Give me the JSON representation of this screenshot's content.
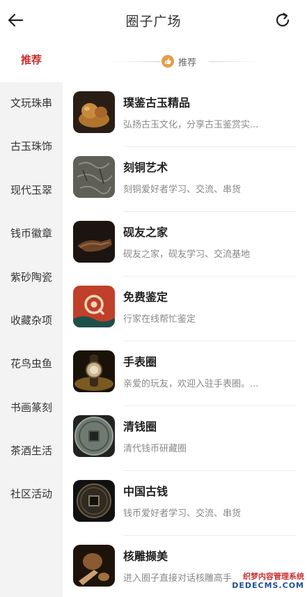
{
  "header": {
    "title": "圈子广场",
    "back_icon": "back-arrow-icon",
    "refresh_icon": "refresh-icon"
  },
  "sidebar": {
    "items": [
      {
        "label": "推荐",
        "active": true
      },
      {
        "label": "文玩珠串",
        "active": false
      },
      {
        "label": "古玉珠饰",
        "active": false
      },
      {
        "label": "现代玉翠",
        "active": false
      },
      {
        "label": "钱币徽章",
        "active": false
      },
      {
        "label": "紫砂陶瓷",
        "active": false
      },
      {
        "label": "收藏杂项",
        "active": false
      },
      {
        "label": "花鸟虫鱼",
        "active": false
      },
      {
        "label": "书画篆刻",
        "active": false
      },
      {
        "label": "茶酒生活",
        "active": false
      },
      {
        "label": "社区活动",
        "active": false
      }
    ]
  },
  "main": {
    "section_label": "推荐",
    "section_icon": "thumbs-up-icon",
    "circles": [
      {
        "name": "璞鉴古玉精品",
        "desc": "弘扬古玉文化，分享古玉鉴赏实..."
      },
      {
        "name": "刻铜艺术",
        "desc": "刻铜爱好者学习、交流、串货"
      },
      {
        "name": "砚友之家",
        "desc": "砚友之家，砚友学习、交流基地"
      },
      {
        "name": "免费鉴定",
        "desc": "行家在线帮忙鉴定"
      },
      {
        "name": "手表圈",
        "desc": "亲爱的玩友，欢迎入驻手表圈。..."
      },
      {
        "name": "清钱圈",
        "desc": "清代钱币研藏圈"
      },
      {
        "name": "中国古钱",
        "desc": "钱币爱好者学习、交流、串货"
      },
      {
        "name": "核雕撷美",
        "desc": "进入圈子直接对话核雕高手"
      }
    ]
  },
  "watermark": {
    "line1": "织梦内容管理系统",
    "line2": "DEDECMS.COM"
  },
  "colors": {
    "accent": "#c8302f",
    "sidebar_bg": "#f3f3f3",
    "thumb_badge": "#e89b45"
  }
}
